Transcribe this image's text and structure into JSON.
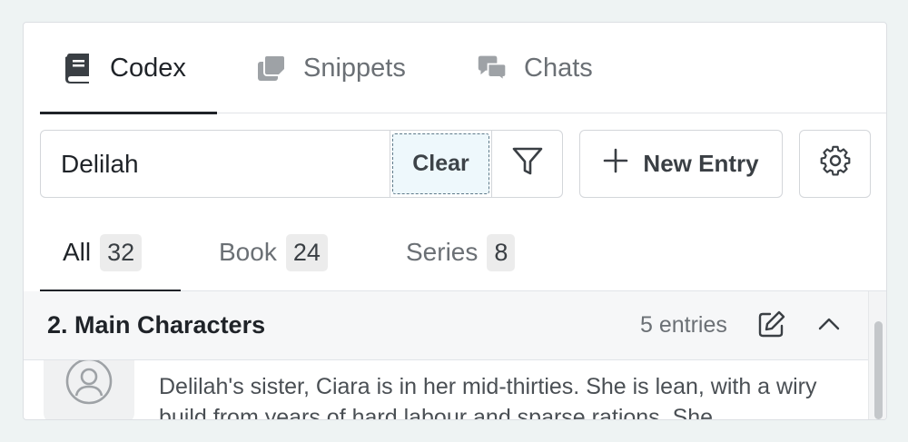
{
  "tabs": [
    {
      "label": "Codex",
      "icon": "book-icon",
      "active": true
    },
    {
      "label": "Snippets",
      "icon": "snippets-icon",
      "active": false
    },
    {
      "label": "Chats",
      "icon": "chats-icon",
      "active": false
    }
  ],
  "search": {
    "value": "Delilah",
    "clear_label": "Clear",
    "filter_icon": "filter-icon"
  },
  "new_entry": {
    "label": "New Entry",
    "icon": "plus-icon"
  },
  "settings": {
    "icon": "gear-icon"
  },
  "filter_tabs": [
    {
      "label": "All",
      "count": "32",
      "active": true
    },
    {
      "label": "Book",
      "count": "24",
      "active": false
    },
    {
      "label": "Series",
      "count": "8",
      "active": false
    }
  ],
  "section": {
    "title": "2. Main Characters",
    "entries": "5 entries",
    "edit_icon": "edit-icon",
    "collapse_icon": "chevron-up-icon"
  },
  "entry": {
    "avatar_icon": "user-icon",
    "text": "Delilah's sister, Ciara is in her mid-thirties. She is lean, with a wiry build from years of hard labour and sparse rations. She"
  },
  "colors": {
    "background": "#eef3f3",
    "active": "#1f2328",
    "muted": "#6b7075",
    "clear_bg": "#eef8fc"
  }
}
